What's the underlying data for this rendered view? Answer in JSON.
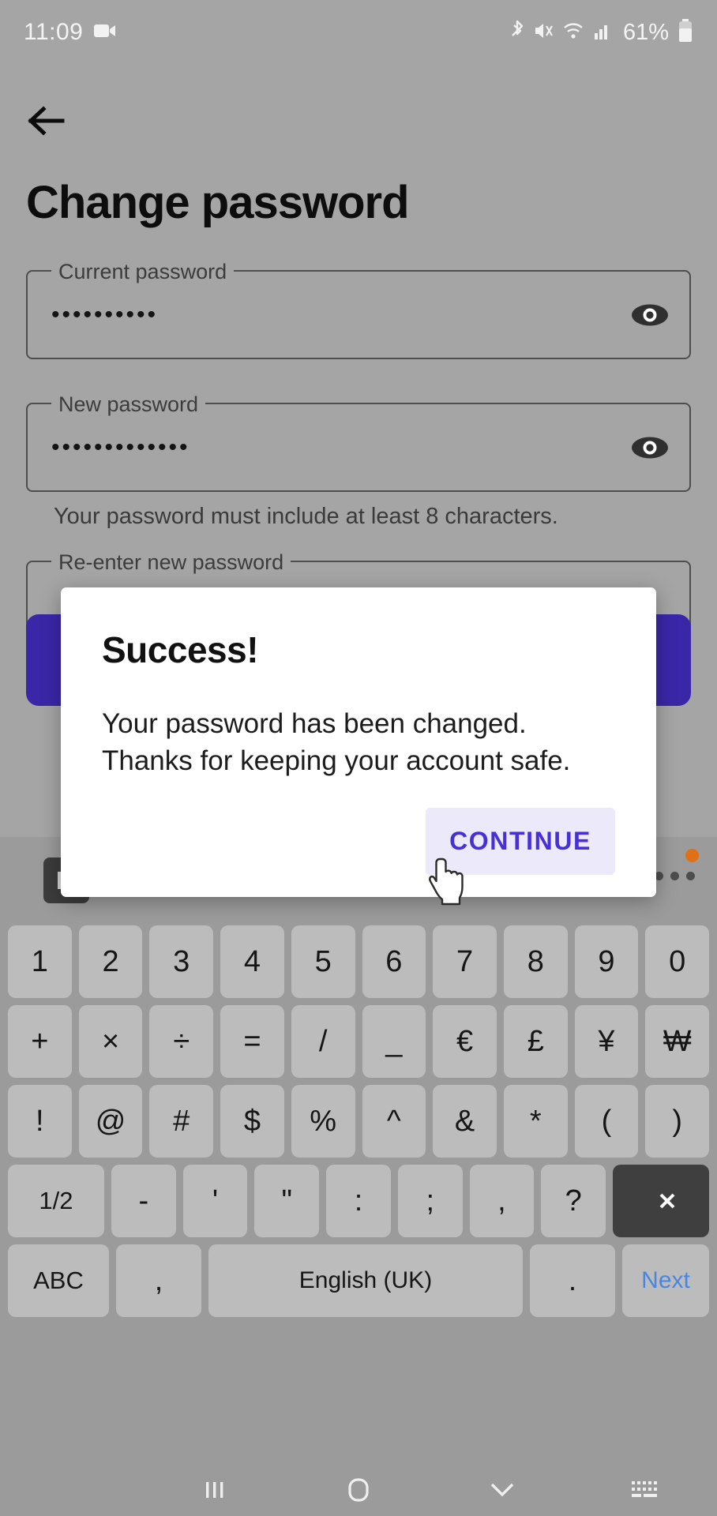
{
  "status_bar": {
    "clock": "11:09",
    "battery": "61%",
    "icons": [
      "screen-record-icon",
      "bluetooth-icon",
      "mute-icon",
      "wifi-icon",
      "signal-icon",
      "battery-icon"
    ]
  },
  "app": {
    "back_icon": "back-arrow-icon",
    "title": "Change password",
    "fields": [
      {
        "label": "Current password",
        "value": "••••••••••",
        "toggle_icon": "eye-icon"
      },
      {
        "label": "New password",
        "value": "•••••••••••••",
        "toggle_icon": "eye-icon"
      },
      {
        "label": "Re-enter new password",
        "value": "",
        "toggle_icon": "eye-icon"
      }
    ],
    "helper_text": "Your password must include at least 8 characters.",
    "submit_label": "",
    "accent_color": "#3a27a8"
  },
  "dialog": {
    "title": "Success!",
    "message": "Your password has been changed. Thanks for keeping your account safe.",
    "continue_label": "CONTINUE",
    "continue_text_color": "#4630d6",
    "continue_bg_color": "#ece9fa"
  },
  "keyboard": {
    "toolbar": {
      "left_icon": "sticker-icon",
      "more_icon": "overflow-menu-icon",
      "badge": "notification-dot"
    },
    "rows": [
      [
        "1",
        "2",
        "3",
        "4",
        "5",
        "6",
        "7",
        "8",
        "9",
        "0"
      ],
      [
        "+",
        "×",
        "÷",
        "=",
        "/",
        "_",
        "€",
        "£",
        "¥",
        "₩"
      ],
      [
        "!",
        "@",
        "#",
        "$",
        "%",
        "^",
        "&",
        "*",
        "(",
        ")"
      ]
    ],
    "row4": {
      "page_toggle": "1/2",
      "keys": [
        "-",
        "'",
        "\"",
        ":",
        ";",
        ",",
        "?"
      ],
      "backspace_icon": "backspace-icon"
    },
    "row5": {
      "abc": "ABC",
      "comma": ",",
      "space": "English (UK)",
      "period": ".",
      "next": "Next"
    }
  },
  "nav_bar": {
    "recents_icon": "recents-icon",
    "home_icon": "home-icon",
    "hide_keyboard_icon": "chevron-down-icon",
    "keyboard_switch_icon": "keyboard-icon"
  }
}
